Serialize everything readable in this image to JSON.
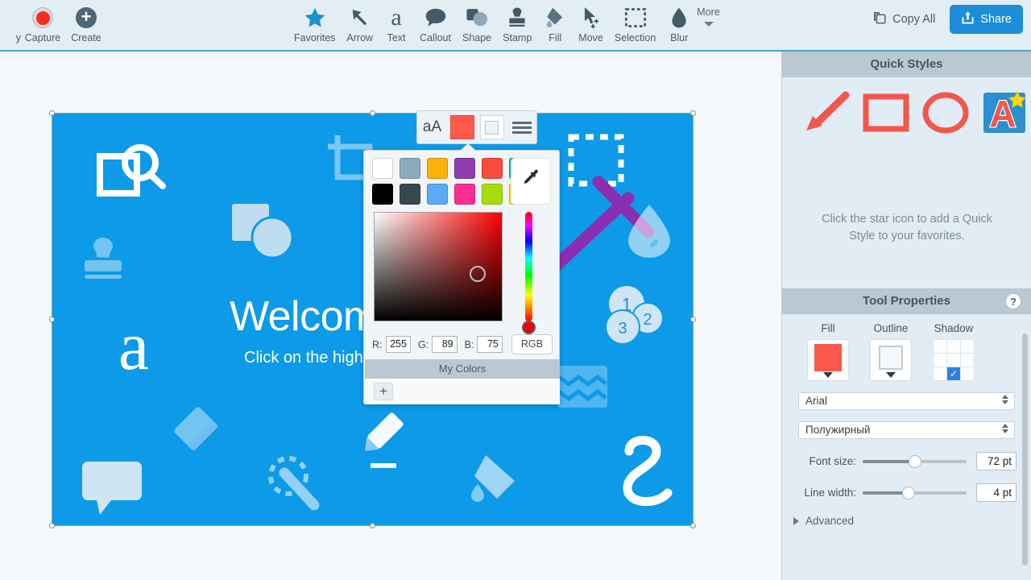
{
  "toolbar": {
    "left_items": [
      {
        "label": "Capture",
        "icon": "record-dot-icon"
      },
      {
        "label": "Create",
        "icon": "plus-circle-icon"
      }
    ],
    "clipped_label": "y",
    "tools": [
      {
        "label": "Favorites",
        "icon": "star-icon",
        "active": true
      },
      {
        "label": "Arrow",
        "icon": "arrow-icon",
        "active": false
      },
      {
        "label": "Text",
        "icon": "text-a-icon",
        "active": false
      },
      {
        "label": "Callout",
        "icon": "speech-bubble-icon",
        "active": false
      },
      {
        "label": "Shape",
        "icon": "shapes-icon",
        "active": false
      },
      {
        "label": "Stamp",
        "icon": "stamp-icon",
        "active": false
      },
      {
        "label": "Fill",
        "icon": "paint-bucket-icon",
        "active": false
      },
      {
        "label": "Move",
        "icon": "move-cursor-icon",
        "active": false
      },
      {
        "label": "Selection",
        "icon": "marquee-selection-icon",
        "active": false
      },
      {
        "label": "Blur",
        "icon": "water-drop-icon",
        "active": false
      }
    ],
    "more_label": "More",
    "copy_all_label": "Copy All",
    "share_label": "Share",
    "accent_blue": "#1b8ddb",
    "bar_bg": "#e3edf4"
  },
  "canvas": {
    "image_bg": "#0d9ae8",
    "heading": "Welcome",
    "subheading": "Click on the highlight",
    "decorative_icons": [
      "crop-square-search-icon",
      "stamp-icon",
      "text-a-icon",
      "shapes-icon",
      "crop-icon",
      "marquee-selection-icon",
      "purple-arrow-icon",
      "water-drop-icon",
      "step-numbers-icon",
      "blur-wave-icon",
      "eraser-icon",
      "callout-bubble-icon",
      "magic-wand-icon",
      "highlighter-pen-icon",
      "squiggle-arrow-icon"
    ],
    "step_numbers": [
      "1",
      "2",
      "3"
    ]
  },
  "style_bar": {
    "font_style_label": "aA",
    "fill_color": "#ff594b",
    "outline_icon": "outline-square-icon",
    "lines_icon": "line-thickness-icon"
  },
  "color_picker": {
    "swatches_row1": [
      "#ffffff",
      "#8cabbd",
      "#fbb108",
      "#8e3eae",
      "#fb4b3d",
      "#02c39c"
    ],
    "swatches_row2": [
      "#000000",
      "#37474f",
      "#5aaaf5",
      "#fb2e92",
      "#a6dc08",
      "#fbd903"
    ],
    "eyedropper_icon": "eyedropper-icon",
    "labels": {
      "r": "R:",
      "g": "G:",
      "b": "B:"
    },
    "values": {
      "r": "255",
      "g": "89",
      "b": "75"
    },
    "mode_button": "RGB",
    "my_colors_title": "My Colors",
    "add_color_label": "+"
  },
  "right_panel": {
    "quick_styles": {
      "title": "Quick Styles",
      "hint_line1": "Click the star icon to add a Quick",
      "hint_line2": "Style to your favorites.",
      "styles": [
        "red-arrow-style",
        "red-rectangle-style",
        "red-ellipse-style",
        "red-text-style"
      ]
    },
    "tool_properties": {
      "title": "Tool Properties",
      "help_label": "?",
      "columns": [
        {
          "label": "Fill",
          "icon": "fill-swatch-icon",
          "color": "#f9584b"
        },
        {
          "label": "Outline",
          "icon": "outline-swatch-icon"
        },
        {
          "label": "Shadow",
          "icon": "shadow-grid-icon",
          "selected_cell": 7
        }
      ],
      "font_family": "Arial",
      "font_weight": "Полужирный",
      "font_size_label": "Font size:",
      "font_size_value": "72 pt",
      "line_width_label": "Line width:",
      "line_width_value": "4 pt",
      "advanced_label": "Advanced"
    }
  }
}
